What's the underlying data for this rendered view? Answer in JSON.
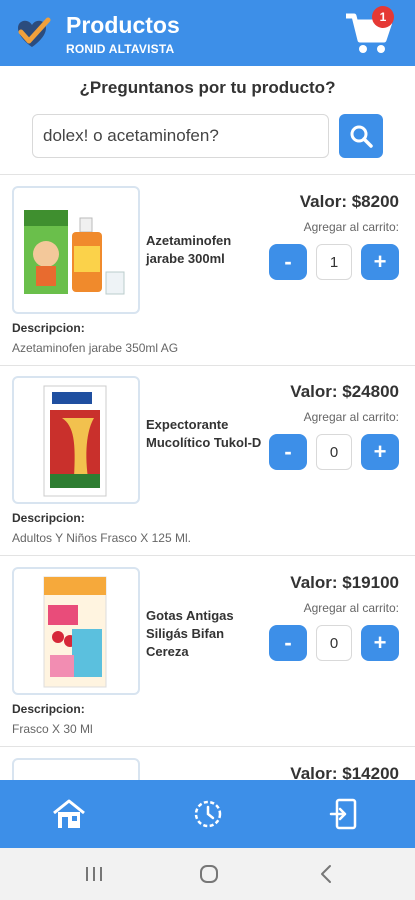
{
  "header": {
    "title": "Productos",
    "subtitle": "RONID ALTAVISTA",
    "cart_count": "1",
    "logo_icon": "check-heart-logo",
    "cart_icon": "shopping-cart-icon"
  },
  "search": {
    "prompt": "¿Preguntanos por tu producto?",
    "placeholder": "dolex! o acetaminofen?",
    "button_icon": "search-icon"
  },
  "products": [
    {
      "name": "Azetaminofen jarabe 300ml",
      "price": "Valor: $8200",
      "add_label": "Agregar al carrito:",
      "qty": "1",
      "minus": "-",
      "plus": "+",
      "desc_label": "Descripcion:",
      "description": "Azetaminofen  jarabe 350ml AG"
    },
    {
      "name": "Expectorante Mucolítico Tukol-D",
      "price": "Valor: $24800",
      "add_label": "Agregar al carrito:",
      "qty": "0",
      "minus": "-",
      "plus": "+",
      "desc_label": "Descripcion:",
      "description": "Adultos Y Niños Frasco X 125 Ml."
    },
    {
      "name": "Gotas Antigas Siligás Bifan Cereza",
      "price": "Valor: $19100",
      "add_label": "Agregar al carrito:",
      "qty": "0",
      "minus": "-",
      "plus": "+",
      "desc_label": "Descripcion:",
      "description": "Frasco X 30 Ml"
    },
    {
      "price": "Valor: $14200"
    }
  ],
  "bottom_nav": {
    "items": [
      "home-icon",
      "history-clock-icon",
      "logout-icon"
    ]
  },
  "system_nav": {
    "items": [
      "recent-apps-icon",
      "home-circle-icon",
      "back-icon"
    ]
  },
  "colors": {
    "primary": "#3d8fe8",
    "badge": "#e53935"
  }
}
